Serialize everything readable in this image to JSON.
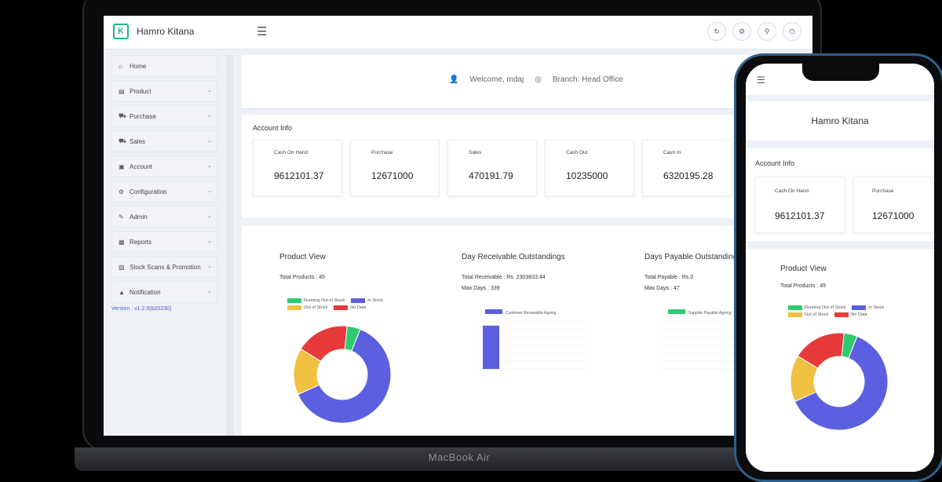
{
  "laptop": {
    "model_label": "MacBook Air",
    "app": {
      "brand": "Hamro Kitana",
      "welcome": "Welcome, mdaj",
      "branch": "Branch: Head Office",
      "version": "Version : v1.2.0(b20230)"
    },
    "sidebar": {
      "items": [
        {
          "label": "Home",
          "icon": "home-icon",
          "chevron": false
        },
        {
          "label": "Product",
          "icon": "product-icon",
          "chevron": true
        },
        {
          "label": "Purchase",
          "icon": "purchase-icon",
          "chevron": true
        },
        {
          "label": "Sales",
          "icon": "sales-icon",
          "chevron": true
        },
        {
          "label": "Account",
          "icon": "account-icon",
          "chevron": true
        },
        {
          "label": "Configuration",
          "icon": "configuration-icon",
          "chevron": true
        },
        {
          "label": "Admin",
          "icon": "admin-icon",
          "chevron": true
        },
        {
          "label": "Reports",
          "icon": "reports-icon",
          "chevron": true
        },
        {
          "label": "Stock Scans & Promotion",
          "icon": "promotion-icon",
          "chevron": true
        },
        {
          "label": "Notification",
          "icon": "notification-icon",
          "chevron": true
        }
      ]
    },
    "account_info": {
      "title": "Account Info",
      "cards": [
        {
          "label": "Cash On Hand",
          "value": "9612101.37"
        },
        {
          "label": "Purchase",
          "value": "12671000"
        },
        {
          "label": "Sales",
          "value": "470191.79"
        },
        {
          "label": "Cash Out",
          "value": "10235000"
        },
        {
          "label": "Cash In",
          "value": "6320195.28"
        }
      ]
    },
    "product_view": {
      "title": "Product View",
      "total": "Total Products : 45"
    },
    "receivable": {
      "title": "Day Receivable Outstandings",
      "total": "Total Receivable : Rs. 2303833.44",
      "max_days": "Max Days : 339"
    },
    "payable": {
      "title": "Days Payable Outstanding",
      "total": "Total Payable : Rs.0",
      "max_days": "Max Days : 47"
    }
  },
  "phone": {
    "brand": "Hamro Kitana",
    "account_title": "Account Info",
    "cards": [
      {
        "label": "Cash On Hand",
        "value": "9612101.37"
      },
      {
        "label": "Purchase",
        "value": "12671000"
      }
    ],
    "product_view": {
      "title": "Product View",
      "total": "Total Products : 45"
    }
  },
  "chart_data": [
    {
      "type": "pie",
      "title": "Product View",
      "labels": [
        "Running Out of Stock",
        "In Stock",
        "Out of Stock",
        "No Data"
      ],
      "values": [
        2,
        28,
        7,
        8
      ],
      "colors": [
        "#2ecc71",
        "#5b5fe0",
        "#f0c040",
        "#e83a3a"
      ]
    },
    {
      "type": "bar",
      "title": "Day Receivable Outstandings",
      "series": [
        {
          "name": "Customer Receivable Ageing",
          "values": [
            2300000,
            0,
            0,
            0
          ]
        }
      ],
      "categories": [
        "",
        "",
        "",
        ""
      ],
      "ylim": [
        0,
        2500000
      ],
      "color": "#5b5fe0"
    },
    {
      "type": "bar",
      "title": "Days Payable Outstanding",
      "series": [
        {
          "name": "Supplier Payable Ageing",
          "values": [
            0,
            0,
            0,
            0
          ]
        }
      ],
      "categories": [
        "",
        "",
        "",
        ""
      ],
      "ylim": [
        0,
        1
      ],
      "color": "#2ecc71"
    }
  ]
}
